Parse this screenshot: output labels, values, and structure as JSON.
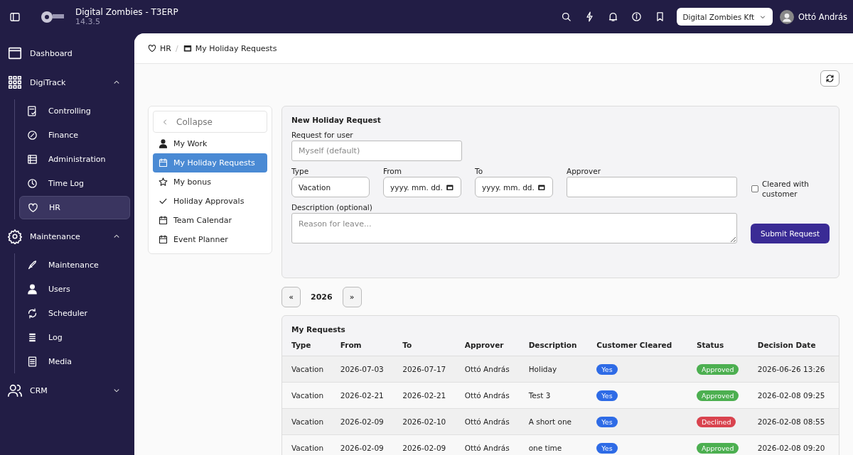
{
  "app": {
    "title": "Digital Zombies - T3ERP",
    "version": "14.3.5"
  },
  "topbar": {
    "company": "Digital Zombies Kft",
    "user": "Ottó András"
  },
  "sidebar": {
    "items": [
      {
        "label": "Dashboard",
        "selected": false
      },
      {
        "label": "DigiTrack",
        "selected": false,
        "expanded": true,
        "children": [
          {
            "label": "Controlling",
            "selected": false
          },
          {
            "label": "Finance",
            "selected": false
          },
          {
            "label": "Administration",
            "selected": false
          },
          {
            "label": "Time Log",
            "selected": false
          },
          {
            "label": "HR",
            "selected": true
          }
        ]
      },
      {
        "label": "Maintenance",
        "selected": false,
        "expanded": true,
        "children": [
          {
            "label": "Maintenance",
            "selected": false
          },
          {
            "label": "Users",
            "selected": false
          },
          {
            "label": "Scheduler",
            "selected": false
          },
          {
            "label": "Log",
            "selected": false
          },
          {
            "label": "Media",
            "selected": false
          }
        ]
      },
      {
        "label": "CRM",
        "selected": false,
        "expanded": false
      }
    ]
  },
  "breadcrumb": {
    "separator": "/",
    "items": [
      "HR",
      "My Holiday Requests"
    ]
  },
  "submenu": {
    "collapse": "Collapse",
    "items": [
      {
        "label": "My Work",
        "selected": false
      },
      {
        "label": "My Holiday Requests",
        "selected": true
      },
      {
        "label": "My bonus",
        "selected": false
      },
      {
        "label": "Holiday Approvals",
        "selected": false
      },
      {
        "label": "Team Calendar",
        "selected": false
      },
      {
        "label": "Event Planner",
        "selected": false
      }
    ]
  },
  "form": {
    "title": "New Holiday Request",
    "user_label": "Request for user",
    "user_placeholder": "Myself (default)",
    "type_label": "Type",
    "type_value": "Vacation",
    "from_label": "From",
    "from_placeholder": "yyyy. mm. dd.",
    "to_label": "To",
    "to_placeholder": "yyyy. mm. dd.",
    "approver_label": "Approver",
    "cleared": {
      "label": "Cleared with customer",
      "checked": false
    },
    "description_label": "Description (optional)",
    "description_placeholder": "Reason for leave...",
    "submit": "Submit Request"
  },
  "year_nav": {
    "prev": "«",
    "year": "2026",
    "next": "»"
  },
  "requests": {
    "title": "My Requests",
    "columns": [
      "Type",
      "From",
      "To",
      "Approver",
      "Description",
      "Customer Cleared",
      "Status",
      "Decision Date"
    ],
    "rows": [
      {
        "type": "Vacation",
        "from": "2026-07-03",
        "to": "2026-07-17",
        "approver": "Ottó András",
        "description": "Holiday",
        "cleared": "Yes",
        "status": "Approved",
        "color": "#4caf50",
        "decision": "2026-06-26 13:26"
      },
      {
        "type": "Vacation",
        "from": "2026-02-21",
        "to": "2026-02-21",
        "approver": "Ottó András",
        "description": "Test 3",
        "cleared": "Yes",
        "status": "Approved",
        "color": "#4caf50",
        "decision": "2026-02-08 09:25"
      },
      {
        "type": "Vacation",
        "from": "2026-02-09",
        "to": "2026-02-10",
        "approver": "Ottó András",
        "description": "A short one",
        "cleared": "Yes",
        "status": "Declined",
        "color": "#d9434e",
        "decision": "2026-02-08 08:55"
      },
      {
        "type": "Vacation",
        "from": "2026-02-09",
        "to": "2026-02-09",
        "approver": "Ottó András",
        "description": "one time",
        "cleared": "Yes",
        "status": "Approved",
        "color": "#4caf50",
        "decision": "2026-02-08 09:20"
      }
    ]
  }
}
